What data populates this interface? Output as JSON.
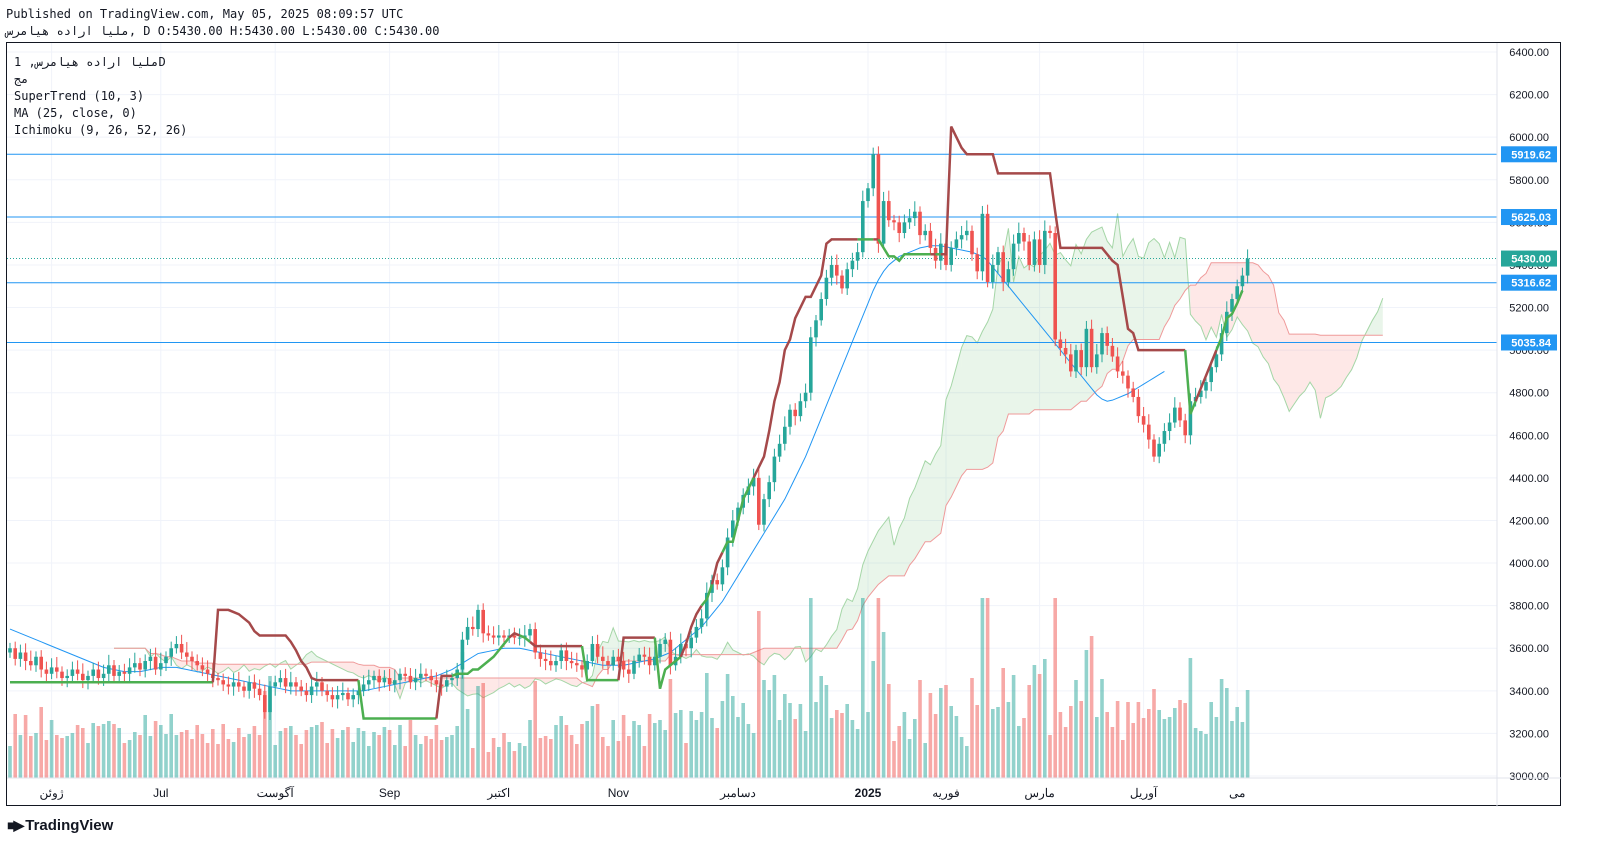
{
  "header": {
    "published_line": "Published on TradingView.com, May 05, 2025 08:09:57 UTC",
    "symbol_line": "ﻣﻠﻴﺎ ﺍﺭﺍﺩﻩ ﻫﻴﺎﻣﺮس, D O:5430.00 H:5430.00 L:5430.00 C:5430.00"
  },
  "legend": {
    "symbol": "ﻣﻠﻴﺎ ﺍﺭﺍﺩﻩ ﻫﻴﺎﻣﺮس, 1D",
    "subtitle": "مج",
    "indicators": [
      "SuperTrend (10, 3)",
      "MA (25, close, 0)",
      "Ichimoku (9, 26, 52, 26)"
    ]
  },
  "footer": {
    "brand": "TradingView"
  },
  "colors": {
    "up": "#26a69a",
    "down": "#ef5350",
    "supertrend_up": "#4caf50",
    "supertrend_down": "#a5494a",
    "ma": "#2196f3",
    "hline": "#2196f3",
    "last_price": "#26a69a",
    "cloud_bull": "rgba(76,175,80,0.12)",
    "cloud_bear": "rgba(244,67,54,0.12)"
  },
  "chart_data": {
    "type": "candlestick",
    "y_axis": {
      "range": [
        3000,
        6500
      ],
      "ticks": [
        3000,
        3200,
        3400,
        3600,
        3800,
        4000,
        4200,
        4400,
        4600,
        4800,
        5000,
        5200,
        5400,
        5600,
        5800,
        6000,
        6200,
        6400
      ]
    },
    "x_axis_labels": [
      {
        "label": "ژوئن",
        "bar": 8
      },
      {
        "label": "Jul",
        "bar": 29
      },
      {
        "label": "آگوست",
        "bar": 51
      },
      {
        "label": "Sep",
        "bar": 73
      },
      {
        "label": "اکتبر",
        "bar": 94
      },
      {
        "label": "Nov",
        "bar": 117
      },
      {
        "label": "دسامبر",
        "bar": 140
      },
      {
        "label": "2025",
        "bar": 165
      },
      {
        "label": "فوریه",
        "bar": 180
      },
      {
        "label": "مارس",
        "bar": 198
      },
      {
        "label": "آوریل",
        "bar": 218
      },
      {
        "label": "می",
        "bar": 236
      }
    ],
    "horizontal_lines": [
      5919.62,
      5625.03,
      5316.62,
      5035.84
    ],
    "last_price": 5430.0,
    "close": [
      3600,
      3550,
      3580,
      3540,
      3520,
      3560,
      3500,
      3480,
      3510,
      3490,
      3460,
      3470,
      3500,
      3480,
      3450,
      3470,
      3500,
      3460,
      3480,
      3520,
      3470,
      3490,
      3480,
      3510,
      3530,
      3500,
      3540,
      3560,
      3500,
      3530,
      3560,
      3600,
      3620,
      3580,
      3560,
      3540,
      3520,
      3500,
      3480,
      3460,
      3450,
      3430,
      3420,
      3440,
      3420,
      3400,
      3440,
      3410,
      3380,
      3300,
      3420,
      3440,
      3460,
      3420,
      3440,
      3420,
      3400,
      3380,
      3420,
      3440,
      3400,
      3380,
      3360,
      3380,
      3390,
      3360,
      3380,
      3400,
      3430,
      3450,
      3470,
      3440,
      3460,
      3430,
      3450,
      3480,
      3470,
      3440,
      3460,
      3480,
      3470,
      3450,
      3430,
      3420,
      3450,
      3460,
      3500,
      3640,
      3700,
      3690,
      3780,
      3670,
      3660,
      3650,
      3660,
      3650,
      3660,
      3650,
      3650,
      3660,
      3690,
      3580,
      3550,
      3540,
      3520,
      3540,
      3590,
      3540,
      3530,
      3520,
      3500,
      3540,
      3620,
      3560,
      3540,
      3520,
      3560,
      3540,
      3500,
      3480,
      3540,
      3570,
      3560,
      3520,
      3560,
      3620,
      3640,
      3520,
      3560,
      3620,
      3600,
      3650,
      3700,
      3740,
      3860,
      3920,
      3900,
      3980,
      4120,
      4200,
      4260,
      4320,
      4360,
      4400,
      4180,
      4300,
      4380,
      4500,
      4560,
      4640,
      4720,
      4690,
      4760,
      4800,
      5060,
      5140,
      5240,
      5340,
      5400,
      5350,
      5290,
      5380,
      5420,
      5460,
      5700,
      5760,
      5920,
      5500,
      5700,
      5610,
      5600,
      5550,
      5600,
      5620,
      5650,
      5540,
      5560,
      5480,
      5420,
      5500,
      5400,
      5480,
      5520,
      5540,
      5560,
      5450,
      5370,
      5640,
      5320,
      5400,
      5460,
      5320,
      5380,
      5500,
      5550,
      5510,
      5400,
      5520,
      5400,
      5560,
      5550,
      5050,
      5010,
      4980,
      4900,
      5000,
      4920,
      5100,
      4920,
      4980,
      5080,
      5020,
      4970,
      4900,
      4880,
      4820,
      4780,
      4690,
      4650,
      4580,
      4500,
      4560,
      4620,
      4660,
      4730,
      4670,
      4600,
      4760,
      4780,
      4810,
      4850,
      4920,
      4980,
      5080,
      5180,
      5240,
      5300,
      5350,
      5430
    ],
    "supertrend": [
      3440,
      3440,
      3440,
      3440,
      3440,
      3440,
      3440,
      3440,
      3440,
      3440,
      3440,
      3440,
      3440,
      3440,
      3440,
      3440,
      3440,
      3440,
      3440,
      3440,
      3440,
      3440,
      3440,
      3440,
      3440,
      3440,
      3440,
      3440,
      3440,
      3440,
      3440,
      3440,
      3440,
      3440,
      3440,
      3440,
      3440,
      3440,
      3440,
      3440,
      3780,
      3780,
      3780,
      3770,
      3760,
      3740,
      3720,
      3680,
      3660,
      3660,
      3660,
      3660,
      3660,
      3660,
      3630,
      3590,
      3540,
      3510,
      3460,
      3450,
      3450,
      3450,
      3450,
      3450,
      3450,
      3450,
      3450,
      3450,
      3270,
      3270,
      3270,
      3270,
      3270,
      3270,
      3270,
      3270,
      3270,
      3270,
      3270,
      3270,
      3270,
      3270,
      3270,
      3470,
      3470,
      3470,
      3480,
      3480,
      3480,
      3500,
      3500,
      3520,
      3540,
      3560,
      3590,
      3620,
      3650,
      3670,
      3660,
      3650,
      3630,
      3610,
      3610,
      3610,
      3610,
      3610,
      3610,
      3610,
      3610,
      3610,
      3610,
      3450,
      3450,
      3450,
      3450,
      3450,
      3450,
      3450,
      3650,
      3650,
      3650,
      3650,
      3650,
      3650,
      3650,
      3410,
      3500,
      3520,
      3540,
      3560,
      3620,
      3700,
      3760,
      3800,
      3830,
      3900,
      4000,
      4050,
      4100,
      4100,
      4200,
      4300,
      4350,
      4400,
      4450,
      4500,
      4620,
      4760,
      4850,
      5000,
      5050,
      5150,
      5200,
      5250,
      5250,
      5300,
      5350,
      5500,
      5520,
      5520,
      5520,
      5520,
      5520,
      5520,
      5520,
      5520,
      5520,
      5520,
      5480,
      5440,
      5440,
      5420,
      5450,
      5450,
      5450,
      5450,
      5450,
      5450,
      5450,
      5450,
      5450,
      6050,
      6000,
      5950,
      5920,
      5920,
      5920,
      5920,
      5920,
      5920,
      5830,
      5830,
      5830,
      5830,
      5830,
      5830,
      5830,
      5830,
      5830,
      5830,
      5830,
      5650,
      5480,
      5480,
      5480,
      5480,
      5480,
      5480,
      5480,
      5480,
      5480,
      5450,
      5420,
      5400,
      5250,
      5100,
      5080,
      5000,
      5000,
      5000,
      5000,
      5000,
      5000,
      5000,
      5000,
      5000,
      5000,
      4700,
      4760,
      4820,
      4880,
      4940,
      5000,
      5060,
      5150,
      5170,
      5220,
      5280
    ],
    "ma25": [
      3690,
      3680,
      3670,
      3660,
      3650,
      3640,
      3630,
      3620,
      3610,
      3600,
      3590,
      3580,
      3570,
      3560,
      3550,
      3540,
      3530,
      3520,
      3510,
      3505,
      3500,
      3495,
      3490,
      3490,
      3490,
      3490,
      3495,
      3500,
      3505,
      3510,
      3510,
      3510,
      3510,
      3505,
      3500,
      3495,
      3490,
      3485,
      3480,
      3475,
      3470,
      3465,
      3460,
      3455,
      3450,
      3445,
      3440,
      3435,
      3430,
      3425,
      3420,
      3415,
      3410,
      3405,
      3400,
      3400,
      3400,
      3400,
      3400,
      3400,
      3400,
      3400,
      3400,
      3400,
      3400,
      3400,
      3400,
      3400,
      3400,
      3405,
      3410,
      3415,
      3420,
      3425,
      3430,
      3435,
      3440,
      3445,
      3450,
      3455,
      3460,
      3465,
      3470,
      3480,
      3490,
      3500,
      3515,
      3530,
      3545,
      3560,
      3575,
      3580,
      3585,
      3590,
      3595,
      3600,
      3600,
      3600,
      3600,
      3595,
      3590,
      3585,
      3580,
      3575,
      3570,
      3565,
      3560,
      3555,
      3550,
      3545,
      3540,
      3535,
      3530,
      3525,
      3520,
      3520,
      3520,
      3520,
      3520,
      3525,
      3530,
      3535,
      3540,
      3545,
      3550,
      3560,
      3570,
      3580,
      3600,
      3620,
      3640,
      3660,
      3680,
      3700,
      3730,
      3760,
      3790,
      3820,
      3860,
      3900,
      3940,
      3980,
      4020,
      4060,
      4100,
      4140,
      4180,
      4220,
      4260,
      4300,
      4350,
      4400,
      4450,
      4500,
      4560,
      4620,
      4680,
      4740,
      4800,
      4860,
      4920,
      4980,
      5040,
      5100,
      5160,
      5220,
      5280,
      5330,
      5370,
      5400,
      5420,
      5440,
      5450,
      5460,
      5470,
      5480,
      5485,
      5490,
      5490,
      5490,
      5485,
      5480,
      5475,
      5470,
      5465,
      5460,
      5450,
      5440,
      5420,
      5390,
      5360,
      5330,
      5300,
      5270,
      5240,
      5210,
      5180,
      5150,
      5120,
      5090,
      5060,
      5030,
      5000,
      4970,
      4940,
      4910,
      4880,
      4850,
      4820,
      4790,
      4770,
      4760,
      4765,
      4775,
      4785,
      4795,
      4810,
      4825,
      4840,
      4855,
      4870,
      4885,
      4900
    ]
  }
}
